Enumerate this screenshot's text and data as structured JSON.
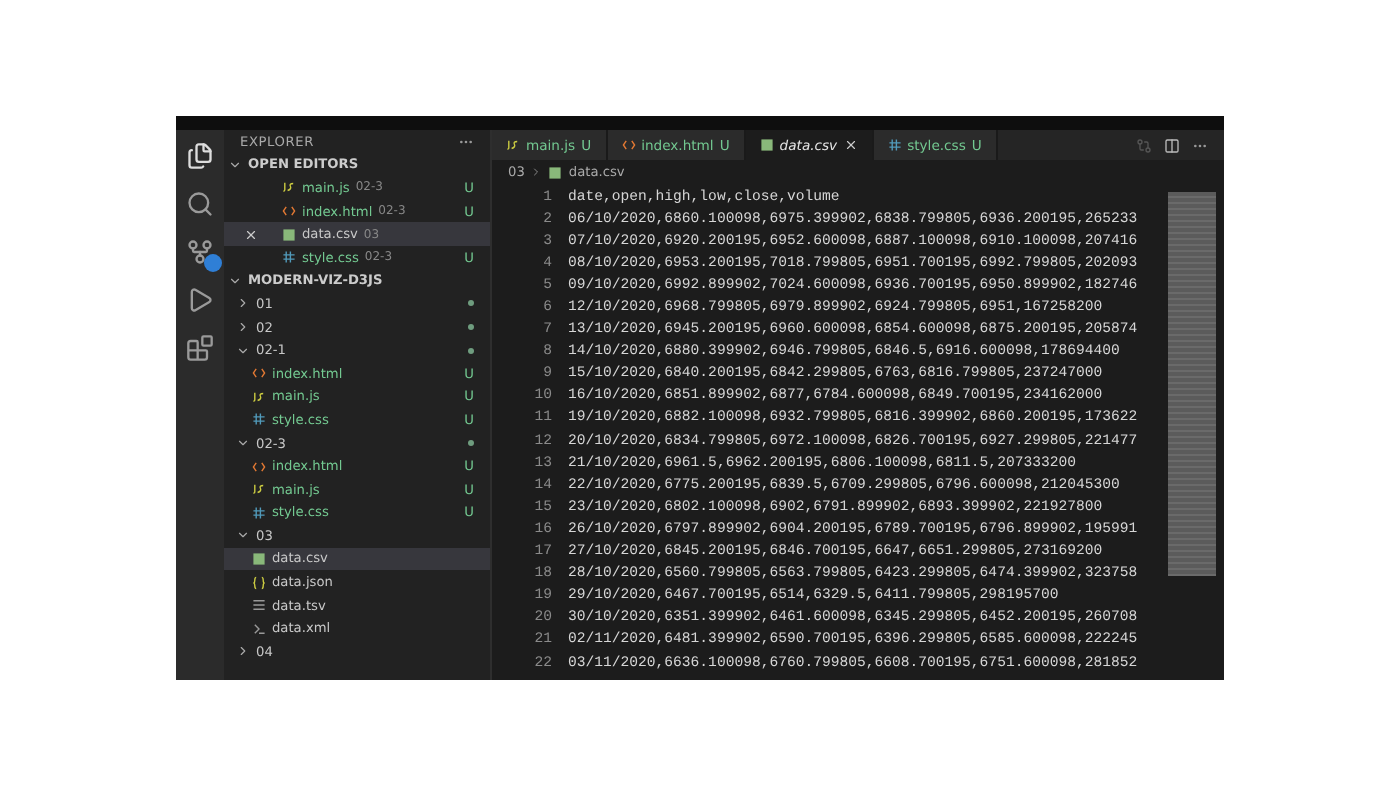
{
  "sidebar": {
    "title": "EXPLORER",
    "open_editors": {
      "title": "OPEN EDITORS",
      "expanded": true,
      "items": [
        {
          "name": "main.js",
          "folder": "02-3",
          "badge": "U",
          "kind": "js",
          "selected": false
        },
        {
          "name": "index.html",
          "folder": "02-3",
          "badge": "U",
          "kind": "html",
          "selected": false
        },
        {
          "name": "data.csv",
          "folder": "03",
          "kind": "csv",
          "selected": true
        },
        {
          "name": "style.css",
          "folder": "02-3",
          "badge": "U",
          "kind": "css",
          "selected": false
        }
      ]
    },
    "project": {
      "title": "MODERN-VIZ-D3JS",
      "expanded": true,
      "children": [
        {
          "name": "01",
          "kind": "folder",
          "expanded": false,
          "changed": true,
          "selected": false
        },
        {
          "name": "02",
          "kind": "folder",
          "expanded": false,
          "changed": true,
          "selected": false
        },
        {
          "name": "02-1",
          "kind": "folder",
          "expanded": true,
          "changed": true,
          "selected": false,
          "children": [
            {
              "name": "index.html",
              "kind": "html",
              "badge": "U",
              "selected": false
            },
            {
              "name": "main.js",
              "kind": "js",
              "badge": "U",
              "selected": false
            },
            {
              "name": "style.css",
              "kind": "css",
              "badge": "U",
              "selected": false
            }
          ]
        },
        {
          "name": "02-3",
          "kind": "folder",
          "expanded": true,
          "changed": true,
          "selected": false,
          "children": [
            {
              "name": "index.html",
              "kind": "html",
              "badge": "U",
              "selected": false
            },
            {
              "name": "main.js",
              "kind": "js",
              "badge": "U",
              "selected": false
            },
            {
              "name": "style.css",
              "kind": "css",
              "badge": "U",
              "selected": false
            }
          ]
        },
        {
          "name": "03",
          "kind": "folder",
          "expanded": true,
          "changed": false,
          "selected": false,
          "children": [
            {
              "name": "data.csv",
              "kind": "csv",
              "selected": true
            },
            {
              "name": "data.json",
              "kind": "json",
              "selected": false
            },
            {
              "name": "data.tsv",
              "kind": "tsv",
              "selected": false
            },
            {
              "name": "data.xml",
              "kind": "xml",
              "selected": false
            }
          ]
        },
        {
          "name": "04",
          "kind": "folder",
          "expanded": false,
          "changed": false,
          "selected": false
        }
      ]
    }
  },
  "tabs": [
    {
      "label": "main.js",
      "kind": "js",
      "badge": "U",
      "selected": false
    },
    {
      "label": "index.html",
      "kind": "html",
      "badge": "U",
      "selected": false
    },
    {
      "label": "data.csv",
      "kind": "csv",
      "selected": true
    },
    {
      "label": "style.css",
      "kind": "css",
      "badge": "U",
      "selected": false
    }
  ],
  "breadcrumb": [
    "03",
    "data.csv"
  ],
  "lines": [
    {
      "number": "1",
      "text": "date,open,high,low,close,volume"
    },
    {
      "number": "2",
      "text": "06/10/2020,6860.100098,6975.399902,6838.799805,6936.200195,265233"
    },
    {
      "number": "3",
      "text": "07/10/2020,6920.200195,6952.600098,6887.100098,6910.100098,207416"
    },
    {
      "number": "4",
      "text": "08/10/2020,6953.200195,7018.799805,6951.700195,6992.799805,202093"
    },
    {
      "number": "5",
      "text": "09/10/2020,6992.899902,7024.600098,6936.700195,6950.899902,182746"
    },
    {
      "number": "6",
      "text": "12/10/2020,6968.799805,6979.899902,6924.799805,6951,167258200"
    },
    {
      "number": "7",
      "text": "13/10/2020,6945.200195,6960.600098,6854.600098,6875.200195,205874"
    },
    {
      "number": "8",
      "text": "14/10/2020,6880.399902,6946.799805,6846.5,6916.600098,178694400"
    },
    {
      "number": "9",
      "text": "15/10/2020,6840.200195,6842.299805,6763,6816.799805,237247000"
    },
    {
      "number": "10",
      "text": "16/10/2020,6851.899902,6877,6784.600098,6849.700195,234162000"
    },
    {
      "number": "11",
      "text": "19/10/2020,6882.100098,6932.799805,6816.399902,6860.200195,173622"
    },
    {
      "number": "12",
      "text": "20/10/2020,6834.799805,6972.100098,6826.700195,6927.299805,221477"
    },
    {
      "number": "13",
      "text": "21/10/2020,6961.5,6962.200195,6806.100098,6811.5,207333200"
    },
    {
      "number": "14",
      "text": "22/10/2020,6775.200195,6839.5,6709.299805,6796.600098,212045300"
    },
    {
      "number": "15",
      "text": "23/10/2020,6802.100098,6902,6791.899902,6893.399902,221927800"
    },
    {
      "number": "16",
      "text": "26/10/2020,6797.899902,6904.200195,6789.700195,6796.899902,195991"
    },
    {
      "number": "17",
      "text": "27/10/2020,6845.200195,6846.700195,6647,6651.299805,273169200"
    },
    {
      "number": "18",
      "text": "28/10/2020,6560.799805,6563.799805,6423.299805,6474.399902,323758"
    },
    {
      "number": "19",
      "text": "29/10/2020,6467.700195,6514,6329.5,6411.799805,298195700"
    },
    {
      "number": "20",
      "text": "30/10/2020,6351.399902,6461.600098,6345.299805,6452.200195,260708"
    },
    {
      "number": "21",
      "text": "02/11/2020,6481.399902,6590.700195,6396.299805,6585.600098,222245"
    },
    {
      "number": "22",
      "text": "03/11/2020,6636.100098,6760.799805,6608.700195,6751.600098,281852"
    }
  ]
}
